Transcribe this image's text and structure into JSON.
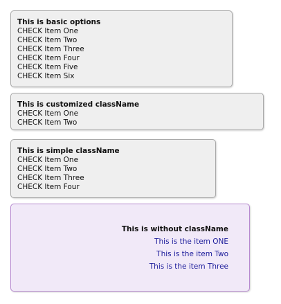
{
  "panels": {
    "basic": {
      "title": "This is basic options",
      "items": [
        "CHECK Item One",
        "CHECK Item Two",
        "CHECK Item Three",
        "CHECK Item Four",
        "CHECK Item Five",
        "CHECK Item Six"
      ]
    },
    "custom": {
      "title": "This is customized className",
      "items": [
        "CHECK Item One",
        "CHECK Item Two"
      ]
    },
    "simple": {
      "title": "This is simple className",
      "items": [
        "CHECK Item One",
        "CHECK Item Two",
        "CHECK Item Three",
        "CHECK Item Four"
      ]
    },
    "without": {
      "title": "This is without className",
      "items": [
        "This is the item ONE",
        "This is the item Two",
        "This is the item Three"
      ]
    }
  },
  "colors": {
    "panel_bg": "#efefef",
    "panel_border": "#a8a8a8",
    "purple_bg": "#f1e9f8",
    "purple_border": "#b78ad0",
    "link_text": "#1a1a9a"
  }
}
